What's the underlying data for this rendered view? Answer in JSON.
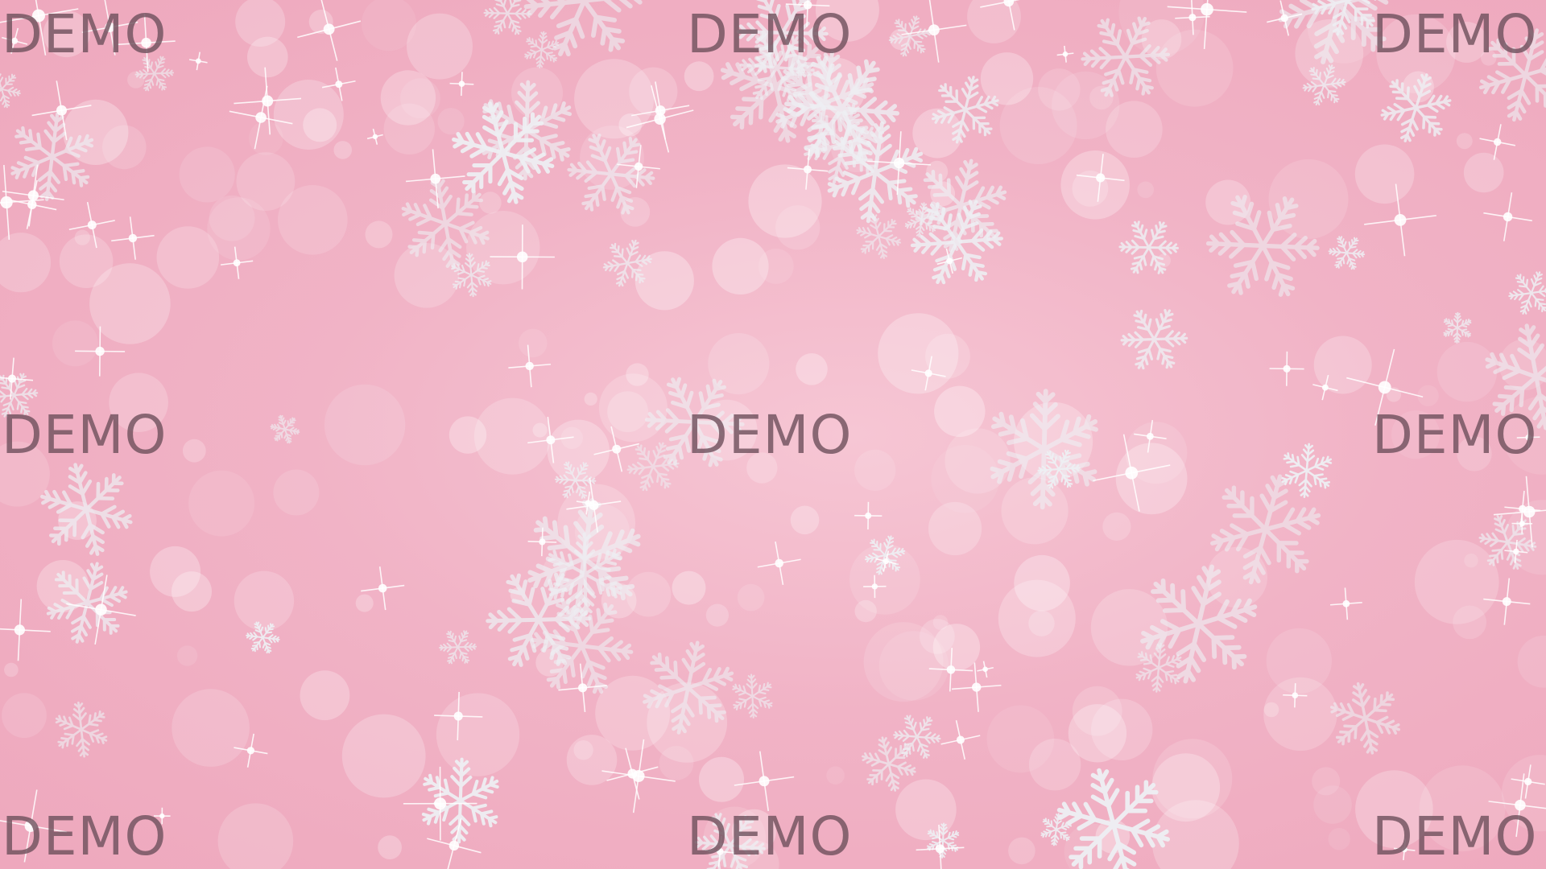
{
  "image": {
    "subject": "pink winter background with snowflakes, bokeh circles and sparkles",
    "colors": {
      "background": "#f1b3c6",
      "snowflake": "#eef0f4",
      "bokeh": "#ffffff",
      "watermark": "#70525e"
    }
  },
  "watermark": {
    "text": "DEMO"
  }
}
